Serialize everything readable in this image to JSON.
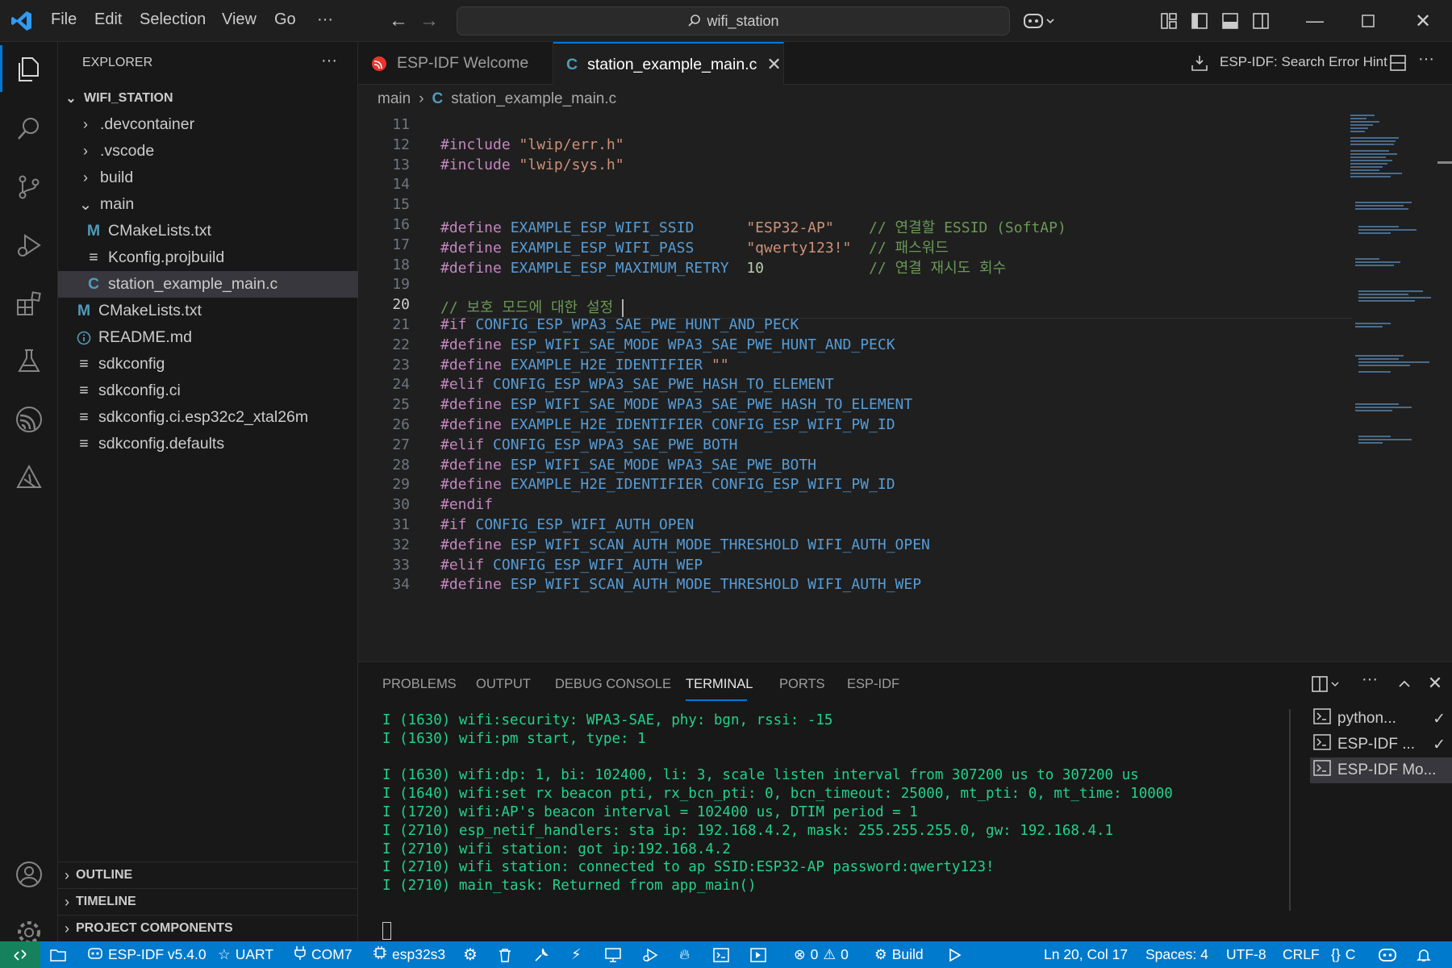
{
  "titlebar": {
    "menus": [
      "File",
      "Edit",
      "Selection",
      "View",
      "Go"
    ],
    "more": "···",
    "search": "wifi_station"
  },
  "tabs": [
    {
      "label": "ESP-IDF Welcome",
      "active": false
    },
    {
      "label": "station_example_main.c",
      "active": true
    }
  ],
  "editor_actions": {
    "hint": "ESP-IDF: Search Error Hint"
  },
  "breadcrumb": {
    "folder": "main",
    "file": "station_example_main.c"
  },
  "explorer": {
    "title": "EXPLORER",
    "root": "WIFI_STATION",
    "items": [
      {
        "label": ".devcontainer",
        "icon": "chevron-right"
      },
      {
        "label": ".vscode",
        "icon": "chevron-right"
      },
      {
        "label": "build",
        "icon": "chevron-right"
      },
      {
        "label": "main",
        "icon": "chevron-down"
      },
      {
        "label": "CMakeLists.txt",
        "icon": "cmake-M"
      },
      {
        "label": "Kconfig.projbuild",
        "icon": "lines"
      },
      {
        "label": "station_example_main.c",
        "icon": "c"
      },
      {
        "label": "CMakeLists.txt",
        "icon": "cmake-M"
      },
      {
        "label": "README.md",
        "icon": "info"
      },
      {
        "label": "sdkconfig",
        "icon": "lines"
      },
      {
        "label": "sdkconfig.ci",
        "icon": "lines"
      },
      {
        "label": "sdkconfig.ci.esp32c2_xtal26m",
        "icon": "lines"
      },
      {
        "label": "sdkconfig.defaults",
        "icon": "lines"
      }
    ],
    "sections": [
      "OUTLINE",
      "TIMELINE",
      "PROJECT COMPONENTS"
    ]
  },
  "code": {
    "current_line": "20",
    "lines": [
      {
        "n": "11",
        "t": ""
      },
      {
        "n": "12",
        "t": "#include \"lwip/err.h\""
      },
      {
        "n": "13",
        "t": "#include \"lwip/sys.h\""
      },
      {
        "n": "14",
        "t": ""
      },
      {
        "n": "15",
        "t": ""
      },
      {
        "n": "16",
        "t": "#define EXAMPLE_ESP_WIFI_SSID      \"ESP32-AP\"    // 연결할 ESSID (SoftAP)"
      },
      {
        "n": "17",
        "t": "#define EXAMPLE_ESP_WIFI_PASS      \"qwerty123!\"  // 패스워드"
      },
      {
        "n": "18",
        "t": "#define EXAMPLE_ESP_MAXIMUM_RETRY  10            // 연결 재시도 회수"
      },
      {
        "n": "19",
        "t": ""
      },
      {
        "n": "20",
        "t": "// 보호 모드에 대한 설정 "
      },
      {
        "n": "21",
        "t": "#if CONFIG_ESP_WPA3_SAE_PWE_HUNT_AND_PECK"
      },
      {
        "n": "22",
        "t": "#define ESP_WIFI_SAE_MODE WPA3_SAE_PWE_HUNT_AND_PECK"
      },
      {
        "n": "23",
        "t": "#define EXAMPLE_H2E_IDENTIFIER \"\""
      },
      {
        "n": "24",
        "t": "#elif CONFIG_ESP_WPA3_SAE_PWE_HASH_TO_ELEMENT"
      },
      {
        "n": "25",
        "t": "#define ESP_WIFI_SAE_MODE WPA3_SAE_PWE_HASH_TO_ELEMENT"
      },
      {
        "n": "26",
        "t": "#define EXAMPLE_H2E_IDENTIFIER CONFIG_ESP_WIFI_PW_ID"
      },
      {
        "n": "27",
        "t": "#elif CONFIG_ESP_WPA3_SAE_PWE_BOTH"
      },
      {
        "n": "28",
        "t": "#define ESP_WIFI_SAE_MODE WPA3_SAE_PWE_BOTH"
      },
      {
        "n": "29",
        "t": "#define EXAMPLE_H2E_IDENTIFIER CONFIG_ESP_WIFI_PW_ID"
      },
      {
        "n": "30",
        "t": "#endif"
      },
      {
        "n": "31",
        "t": "#if CONFIG_ESP_WIFI_AUTH_OPEN"
      },
      {
        "n": "32",
        "t": "#define ESP_WIFI_SCAN_AUTH_MODE_THRESHOLD WIFI_AUTH_OPEN"
      },
      {
        "n": "33",
        "t": "#elif CONFIG_ESP_WIFI_AUTH_WEP"
      },
      {
        "n": "34",
        "t": "#define ESP_WIFI_SCAN_AUTH_MODE_THRESHOLD WIFI_AUTH_WEP"
      }
    ]
  },
  "panel": {
    "tabs": [
      "PROBLEMS",
      "OUTPUT",
      "DEBUG CONSOLE",
      "TERMINAL",
      "PORTS",
      "ESP-IDF"
    ],
    "active_tab": "TERMINAL",
    "terminal_lines": [
      "I (1630) wifi:security: WPA3-SAE, phy: bgn, rssi: -15",
      "I (1630) wifi:pm start, type: 1",
      "",
      "I (1630) wifi:dp: 1, bi: 102400, li: 3, scale listen interval from 307200 us to 307200 us",
      "I (1640) wifi:set rx beacon pti, rx_bcn_pti: 0, bcn_timeout: 25000, mt_pti: 0, mt_time: 10000",
      "I (1720) wifi:AP's beacon interval = 102400 us, DTIM period = 1",
      "I (2710) esp_netif_handlers: sta ip: 192.168.4.2, mask: 255.255.255.0, gw: 192.168.4.1",
      "I (2710) wifi station: got ip:192.168.4.2",
      "I (2710) wifi station: connected to ap SSID:ESP32-AP password:qwerty123!",
      "I (2710) main_task: Returned from app_main()"
    ],
    "terminals": [
      {
        "label": "python...",
        "check": "✓"
      },
      {
        "label": "ESP-IDF ...",
        "check": "✓"
      },
      {
        "label": "ESP-IDF Mo...",
        "check": ""
      }
    ]
  },
  "statusbar": {
    "idf": "ESP-IDF v5.4.0",
    "uart": "UART",
    "port": "COM7",
    "target": "esp32s3",
    "errors": "0",
    "warnings": "0",
    "build": "Build",
    "position": "Ln 20, Col 17",
    "spaces": "Spaces: 4",
    "encoding": "UTF-8",
    "eol": "CRLF",
    "language": "C"
  },
  "colors": {
    "accent": "#007acc",
    "terminal_text": "#23d18b",
    "activity_active": "#0078d4"
  }
}
